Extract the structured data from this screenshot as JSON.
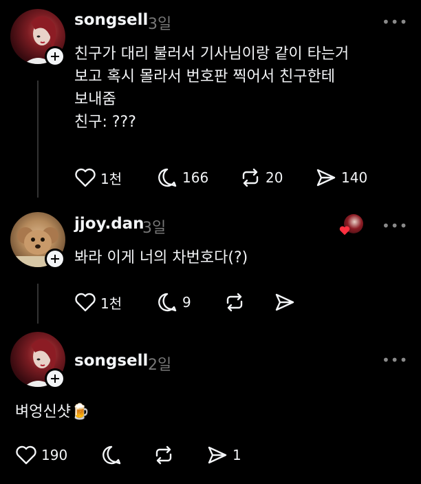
{
  "posts": [
    {
      "username": "songsell",
      "time": "3일",
      "lines": [
        "친구가 대리 불러서 기사님이랑 같이 타는거",
        "보고 혹시 몰라서 번호판 찍어서 친구한테",
        "보내줌",
        "친구: ???"
      ],
      "actions": {
        "likes": "1천",
        "comments": "166",
        "reposts": "20",
        "shares": "140"
      }
    },
    {
      "username": "jjoy.dan",
      "time": "3일",
      "lines": [
        "봐라 이게 너의 차번호다(?)"
      ],
      "actions": {
        "likes": "1천",
        "comments": "9",
        "reposts": "",
        "shares": ""
      }
    },
    {
      "username": "songsell",
      "time": "2일",
      "lines": [
        "벼엉신샷🍺"
      ],
      "actions": {
        "likes": "190",
        "comments": "",
        "reposts": "",
        "shares": "1"
      }
    }
  ],
  "more_label": "•••",
  "icons": {
    "like": "heart-icon",
    "comment": "comment-bubble-icon",
    "repost": "repost-icon",
    "share": "share-send-icon",
    "author_liked": "heart-liked-badge-icon"
  },
  "colors": {
    "background": "#000000",
    "text": "#f3f5f7",
    "muted": "#777777",
    "like_red": "#ff3040"
  }
}
